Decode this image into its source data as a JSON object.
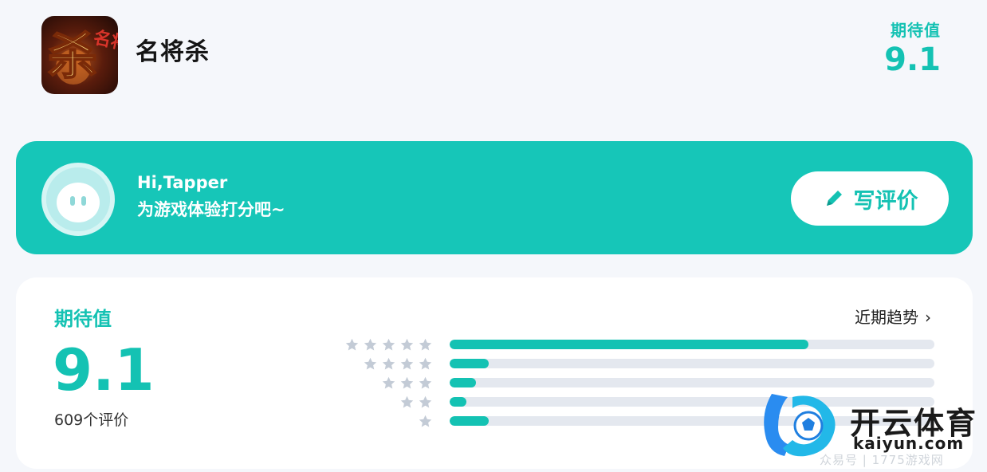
{
  "app": {
    "name": "名将杀",
    "icon": "game-logo-icon"
  },
  "expectation_top": {
    "label": "期待值",
    "value": "9.1"
  },
  "banner": {
    "greeting": "Hi,Tapper",
    "prompt": "为游戏体验打分吧~",
    "avatar_icon": "robot-avatar-icon",
    "write_review_label": "写评价",
    "write_review_icon": "pencil-icon"
  },
  "rating": {
    "label": "期待值",
    "score": "9.1",
    "count_text": "609个评价",
    "trend_label": "近期趋势",
    "trend_icon": "chevron-right-icon",
    "distribution": [
      {
        "stars": 5,
        "fraction": 0.74
      },
      {
        "stars": 4,
        "fraction": 0.08
      },
      {
        "stars": 3,
        "fraction": 0.055
      },
      {
        "stars": 2,
        "fraction": 0.035
      },
      {
        "stars": 1,
        "fraction": 0.08
      }
    ]
  },
  "watermark": {
    "brand": "开云体育",
    "domain": "kaiyun.com",
    "credit": "众易号 | 1775游戏网"
  },
  "colors": {
    "accent": "#14c2b3",
    "banner": "#16c6b8",
    "track": "#e4e8ef",
    "star_gray": "#c3cbd6",
    "background": "#f5f7fb"
  }
}
